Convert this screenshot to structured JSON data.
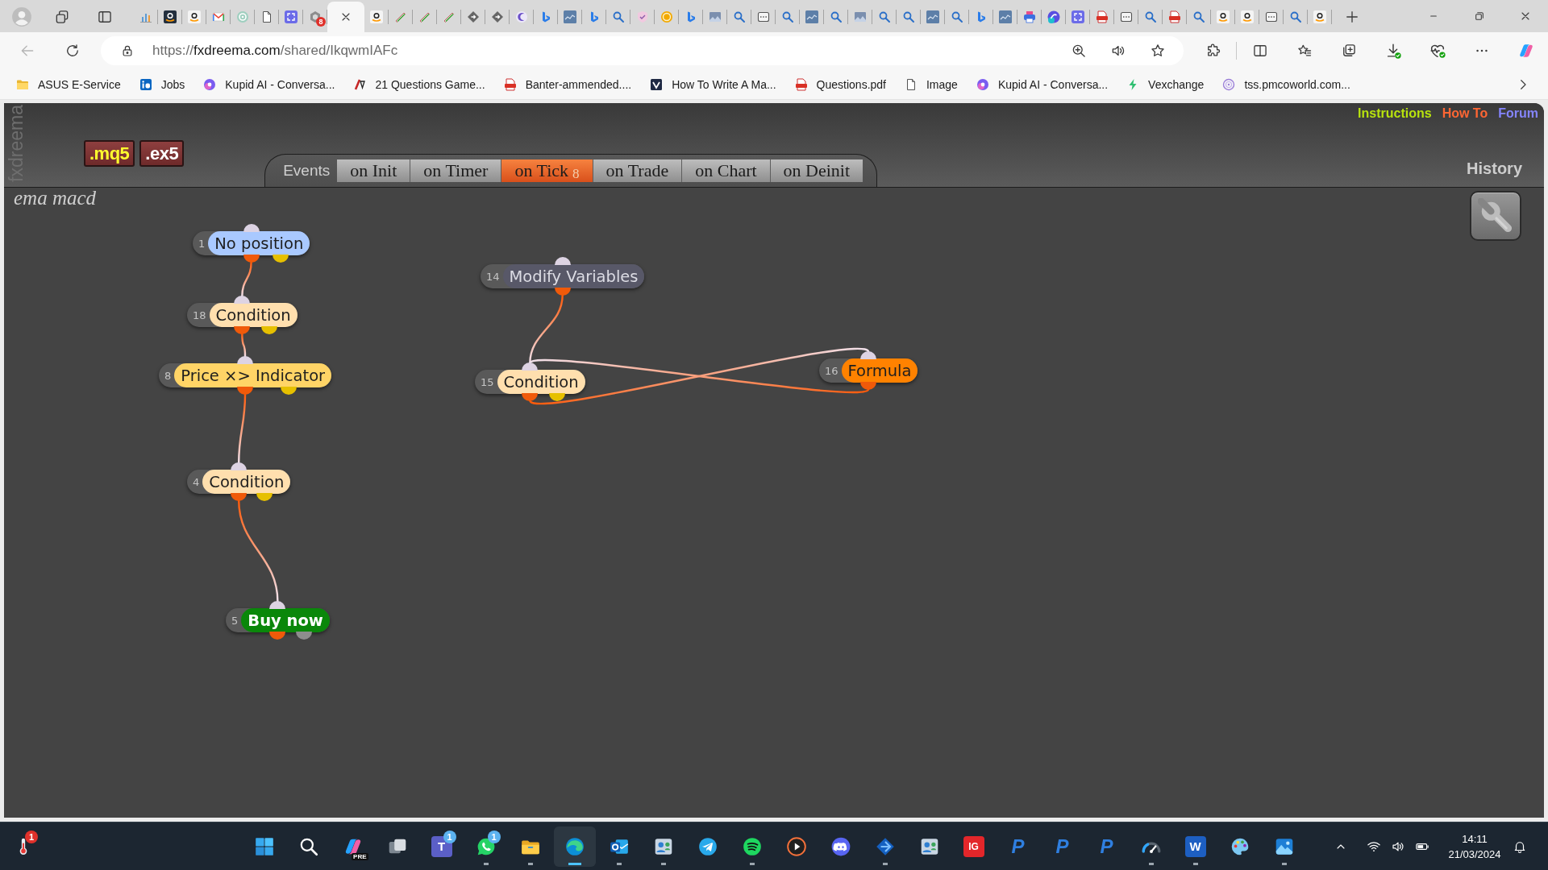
{
  "browser": {
    "tabs": [
      {
        "kind": "chart",
        "selected": false
      },
      {
        "kind": "smile-dark",
        "selected": false
      },
      {
        "kind": "smile",
        "selected": false
      },
      {
        "kind": "mail",
        "selected": false
      },
      {
        "kind": "flower",
        "selected": false
      },
      {
        "kind": "page",
        "selected": false
      },
      {
        "kind": "expand",
        "selected": false
      },
      {
        "kind": "hexagon",
        "badge": "8",
        "selected": false
      },
      {
        "selected": true
      },
      {
        "kind": "smile",
        "selected": false
      },
      {
        "kind": "pen",
        "selected": false
      },
      {
        "kind": "pen",
        "selected": false
      },
      {
        "kind": "pen",
        "selected": false
      },
      {
        "kind": "diamond",
        "selected": false
      },
      {
        "kind": "diamond",
        "selected": false
      },
      {
        "kind": "crescent",
        "selected": false
      },
      {
        "kind": "ribbon",
        "selected": false
      },
      {
        "kind": "tile",
        "selected": false
      },
      {
        "kind": "ribbon",
        "selected": false
      },
      {
        "kind": "search",
        "selected": false
      },
      {
        "kind": "shield",
        "selected": false
      },
      {
        "kind": "coin",
        "selected": false
      },
      {
        "kind": "ribbon",
        "selected": false
      },
      {
        "kind": "image",
        "selected": false
      },
      {
        "kind": "search",
        "selected": false
      },
      {
        "kind": "window",
        "selected": false
      },
      {
        "kind": "search",
        "selected": false
      },
      {
        "kind": "tile",
        "selected": false
      },
      {
        "kind": "search",
        "selected": false
      },
      {
        "kind": "image",
        "selected": false
      },
      {
        "kind": "search",
        "selected": false
      },
      {
        "kind": "search",
        "selected": false
      },
      {
        "kind": "tile",
        "selected": false
      },
      {
        "kind": "search",
        "selected": false
      },
      {
        "kind": "ribbon",
        "selected": false
      },
      {
        "kind": "tile",
        "selected": false
      },
      {
        "kind": "printer",
        "selected": false
      },
      {
        "kind": "circle",
        "selected": false
      },
      {
        "kind": "expand",
        "selected": false
      },
      {
        "kind": "pdf",
        "selected": false
      },
      {
        "kind": "window",
        "selected": false
      },
      {
        "kind": "search",
        "selected": false
      },
      {
        "kind": "pdf",
        "selected": false
      },
      {
        "kind": "search",
        "selected": false
      },
      {
        "kind": "smile",
        "selected": false
      },
      {
        "kind": "smile",
        "selected": false
      },
      {
        "kind": "window",
        "selected": false
      },
      {
        "kind": "search",
        "selected": false
      },
      {
        "kind": "smile",
        "selected": false
      }
    ],
    "toolbar": {
      "back": {
        "disabled": true
      },
      "url": [
        {
          "text": "https://",
          "emphasis": false
        },
        {
          "text": "fxdreema.com",
          "emphasis": true
        },
        {
          "text": "/shared/IkqwmIAFc",
          "emphasis": false
        }
      ]
    },
    "bookmarks": [
      {
        "kind": "folder",
        "label": "ASUS E-Service"
      },
      {
        "kind": "linkedin",
        "label": "Jobs"
      },
      {
        "kind": "kupid",
        "label": "Kupid AI - Conversa..."
      },
      {
        "kind": "tv",
        "label": "21 Questions Game..."
      },
      {
        "kind": "pdf",
        "label": "Banter-ammended...."
      },
      {
        "kind": "v",
        "label": "How To Write A Ma..."
      },
      {
        "kind": "pdf",
        "label": "Questions.pdf"
      },
      {
        "kind": "page",
        "label": "Image"
      },
      {
        "kind": "kupid",
        "label": "Kupid AI - Conversa..."
      },
      {
        "kind": "bolt",
        "label": "Vexchange"
      },
      {
        "kind": "globe",
        "label": "tss.pmcoworld.com..."
      }
    ]
  },
  "app": {
    "logo": "fxdreema",
    "export_buttons": [
      {
        "label": ".mq5",
        "color": "#ffff2e"
      },
      {
        "label": ".ex5",
        "color": "#ffffff"
      }
    ],
    "events": {
      "label": "Events",
      "tabs": [
        {
          "label": "on Init",
          "selected": false
        },
        {
          "label": "on Timer",
          "selected": false
        },
        {
          "label": "on Tick",
          "count": "8",
          "selected": true
        },
        {
          "label": "on Trade",
          "selected": false
        },
        {
          "label": "on Chart",
          "selected": false
        },
        {
          "label": "on Deinit",
          "selected": false
        }
      ]
    },
    "links": [
      {
        "label": "Instructions",
        "color": "#b8e30e"
      },
      {
        "label": "How To",
        "color": "#ff6633"
      },
      {
        "label": "Forum",
        "color": "#8585ff"
      }
    ],
    "history": "History",
    "project_name": "ema macd",
    "nodes": [
      {
        "number": "1",
        "label": "No position",
        "kind": "check",
        "color": "#a9c9ff"
      },
      {
        "number": "18",
        "label": "Condition",
        "kind": "check",
        "color": "#ffdfae"
      },
      {
        "number": "8",
        "label": "Price ×> Indicator",
        "kind": "check",
        "color": "#ffd466"
      },
      {
        "number": "4",
        "label": "Condition",
        "kind": "check",
        "color": "#ffdfae"
      },
      {
        "number": "5",
        "label": "Buy now",
        "kind": "trade",
        "color": "#0a870a"
      },
      {
        "number": "14",
        "label": "Modify Variables",
        "kind": "action",
        "color": "#585868"
      },
      {
        "number": "15",
        "label": "Condition",
        "kind": "check",
        "color": "#ffdfae"
      },
      {
        "number": "16",
        "label": "Formula",
        "kind": "action",
        "color": "#ff8200"
      }
    ]
  },
  "taskbar": {
    "weather": {
      "badge": "1"
    },
    "apps": [
      {
        "kind": "start",
        "running": false,
        "selected": false
      },
      {
        "kind": "search",
        "running": false,
        "selected": false
      },
      {
        "kind": "copilot",
        "tag": "PRE",
        "running": false,
        "selected": false
      },
      {
        "kind": "taskview",
        "running": false,
        "selected": false
      },
      {
        "kind": "teams",
        "glyph": "T",
        "badge": "1",
        "running": false,
        "selected": false
      },
      {
        "kind": "whatsapp",
        "badge": "1",
        "running": true,
        "selected": false
      },
      {
        "kind": "explorer",
        "running": true,
        "selected": false
      },
      {
        "kind": "edge",
        "running": true,
        "selected": true
      },
      {
        "kind": "outlook",
        "running": true,
        "selected": false
      },
      {
        "kind": "contacts",
        "running": true,
        "selected": false
      },
      {
        "kind": "telegram",
        "running": false,
        "selected": false
      },
      {
        "kind": "spotify",
        "running": true,
        "selected": false
      },
      {
        "kind": "media",
        "running": false,
        "selected": false
      },
      {
        "kind": "discord",
        "running": false,
        "selected": false
      },
      {
        "kind": "diamond",
        "running": true,
        "selected": false
      },
      {
        "kind": "contacts",
        "running": false,
        "selected": false
      },
      {
        "kind": "tile",
        "glyph": "IG",
        "running": false,
        "selected": false
      },
      {
        "kind": "letter",
        "glyph": "P",
        "running": false,
        "selected": false
      },
      {
        "kind": "letter",
        "glyph": "P",
        "running": false,
        "selected": false
      },
      {
        "kind": "letter",
        "glyph": "P",
        "running": false,
        "selected": false
      },
      {
        "kind": "gauge",
        "running": true,
        "selected": false
      },
      {
        "kind": "word",
        "glyph": "W",
        "running": true,
        "selected": false
      },
      {
        "kind": "palette",
        "running": false,
        "selected": false
      },
      {
        "kind": "photos",
        "running": true,
        "selected": false
      }
    ],
    "tray": {
      "time": "14:11",
      "date": "21/03/2024"
    }
  }
}
